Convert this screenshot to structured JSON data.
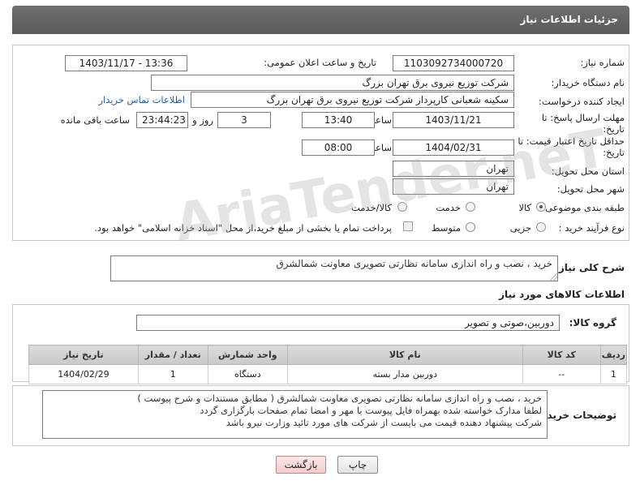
{
  "header": {
    "title": "جزئیات اطلاعات نیاز"
  },
  "fields": {
    "need_number_label": "شماره نیاز:",
    "need_number": "1103092734000720",
    "announce_label": "تاریخ و ساعت اعلان عمومی:",
    "announce_value": "1403/11/17 - 13:36",
    "buyer_org_label": "نام دستگاه خریدار:",
    "buyer_org": "شرکت توزیع نیروی برق تهران بزرگ",
    "creator_label": "ایجاد کننده درخواست:",
    "creator": "سکینه شعبانی کارپرداز شرکت توزیع نیروی برق تهران بزرگ",
    "contact_link": "اطلاعات تماس خریدار",
    "deadline_label": "مهلت ارسال پاسخ: تا تاریخ:",
    "deadline_date": "1403/11/21",
    "time_label": "ساعت",
    "deadline_time": "13:40",
    "days_value": "3",
    "days_label": "روز و",
    "remaining_time": "23:44:23",
    "remaining_label": "ساعت باقی مانده",
    "validity_label": "حداقل تاریخ اعتبار قیمت: تا تاریخ:",
    "validity_date": "1404/02/31",
    "validity_time": "08:00",
    "province_label": "استان محل تحویل:",
    "province": "تهران",
    "city_label": "شهر محل تحویل:",
    "city": "تهران",
    "category_label": "طبقه بندی موضوعی:",
    "category_options": [
      "کالا",
      "خدمت",
      "کالا/خدمت"
    ],
    "purchase_type_label": "نوع فرآیند خرید :",
    "purchase_options": [
      "جزیی",
      "متوسط"
    ],
    "payment_note": "پرداخت تمام یا بخشی از مبلغ خرید،از محل \"اسناد خزانه اسلامی\" خواهد بود."
  },
  "summary": {
    "label": "شرح کلی نیاز:",
    "text": "خرید ، نصب و راه اندازی سامانه نظارتی تصویری معاونت شمالشرق"
  },
  "goods_info": {
    "title": "اطلاعات کالاهای مورد نیاز",
    "group_label": "گروه کالا:",
    "group_value": "دوربین،صوتی و تصویر"
  },
  "table": {
    "headers": [
      "ردیف",
      "کد کالا",
      "نام کالا",
      "واحد شمارش",
      "تعداد / مقدار",
      "تاریخ نیاز"
    ],
    "rows": [
      [
        "1",
        "--",
        "دوربین مدار بسته",
        "دستگاه",
        "1",
        "1404/02/29"
      ]
    ]
  },
  "buyer_notes": {
    "label": "توضیحات خریدار:",
    "lines": [
      "خرید ، نصب و راه اندازی سامانه نظارتی تصویری معاونت شمالشرق ( مطابق مستندات و شرح پیوست )",
      "لطفا مدارک خواسته شده بهمراه فایل پیوست با مهر و امضا تمام صفحات بارگزاری گردد",
      "شرکت پیشنهاد دهنده قیمت می بایست از شرکت های مورد تائید وزارت نیرو باشد"
    ]
  },
  "buttons": {
    "print": "چاپ",
    "back": "بازگشت"
  },
  "watermark": "AriaTender.neT"
}
